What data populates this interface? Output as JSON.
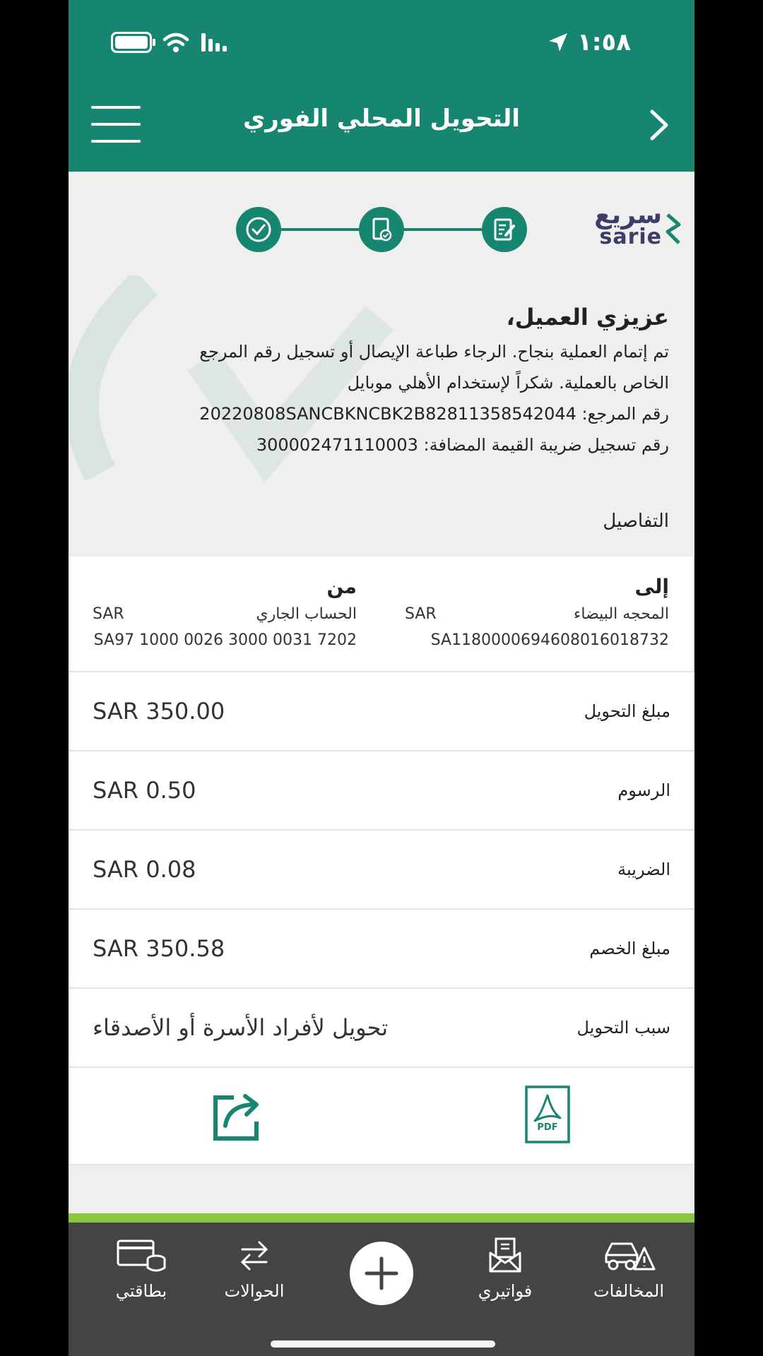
{
  "status_bar": {
    "time": "١:٥٨"
  },
  "header": {
    "title": "التحويل المحلي الفوري"
  },
  "logo": {
    "arabic": "سريع",
    "latin": "sarie"
  },
  "message": {
    "greeting": "عزيزي العميل،",
    "line1": "تم إتمام العملية بنجاح. الرجاء طباعة الإيصال أو تسجيل رقم المرجع",
    "line2": "الخاص بالعملية. شكراً لإستخدام الأهلي موبايل",
    "reference_label": "رقم المرجع:",
    "reference_value": "20220808SANCBKNCBK2B82811358542044",
    "vat_label": "رقم تسجيل ضريبة القيمة المضافة:",
    "vat_value": "300002471110003"
  },
  "details_title": "التفاصيل",
  "from": {
    "label": "من",
    "account_name": "الحساب الجاري",
    "currency": "SAR",
    "iban": "SA97 1000 0026 3000 0031 7202"
  },
  "to": {
    "label": "إلى",
    "account_name": "المحجه البيضاء",
    "currency": "SAR",
    "iban": "SA1180000694608016018732"
  },
  "rows": [
    {
      "label": "مبلغ التحويل",
      "value": "SAR 350.00"
    },
    {
      "label": "الرسوم",
      "value": "SAR 0.50"
    },
    {
      "label": "الضريبة",
      "value": "SAR 0.08"
    },
    {
      "label": "مبلغ الخصم",
      "value": "SAR 350.58"
    },
    {
      "label": "سبب التحويل",
      "value": "تحويل لأفراد الأسرة أو الأصدقاء"
    }
  ],
  "pdf_label": "PDF",
  "nav": {
    "cards": "بطاقتي",
    "transfers": "الحوالات",
    "bills": "فواتيري",
    "violations": "المخالفات"
  },
  "colors": {
    "primary": "#168670",
    "accent_strip": "#8cc63f",
    "nav_bg": "#444444"
  }
}
